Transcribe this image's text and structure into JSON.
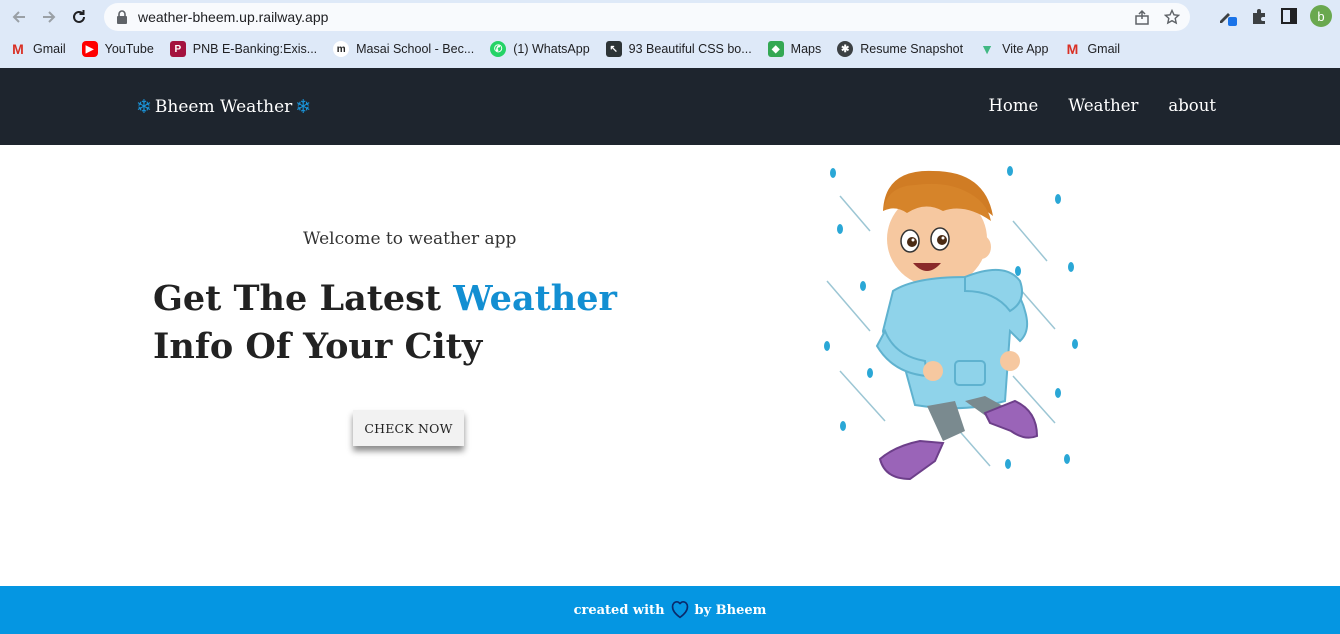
{
  "browser": {
    "url": "weather-bheem.up.railway.app",
    "avatar_letter": "b",
    "bookmarks": [
      {
        "label": "Gmail",
        "icon": "gmail-icon"
      },
      {
        "label": "YouTube",
        "icon": "youtube-icon"
      },
      {
        "label": "PNB E-Banking:Exis...",
        "icon": "pnb-icon"
      },
      {
        "label": "Masai School - Bec...",
        "icon": "masai-icon"
      },
      {
        "label": "(1) WhatsApp",
        "icon": "whatsapp-icon"
      },
      {
        "label": "93 Beautiful CSS bo...",
        "icon": "css-icon"
      },
      {
        "label": "Maps",
        "icon": "maps-icon"
      },
      {
        "label": "Resume Snapshot",
        "icon": "resume-icon"
      },
      {
        "label": "Vite App",
        "icon": "vite-icon"
      },
      {
        "label": "Gmail",
        "icon": "gmail-icon"
      }
    ]
  },
  "nav": {
    "brand": "Bheem Weather",
    "links": [
      {
        "label": "Home"
      },
      {
        "label": "Weather"
      },
      {
        "label": "about"
      }
    ]
  },
  "hero": {
    "welcome": "Welcome to weather app",
    "headline_pre": "Get The Latest ",
    "headline_accent": "Weather",
    "headline_post": " Info Of Your City",
    "cta": "CHECK NOW"
  },
  "footer": {
    "pre": "created with",
    "post": "by Bheem"
  },
  "colors": {
    "nav_bg": "#1e252e",
    "accent": "#138fd2",
    "footer_bg": "#0596e2"
  }
}
